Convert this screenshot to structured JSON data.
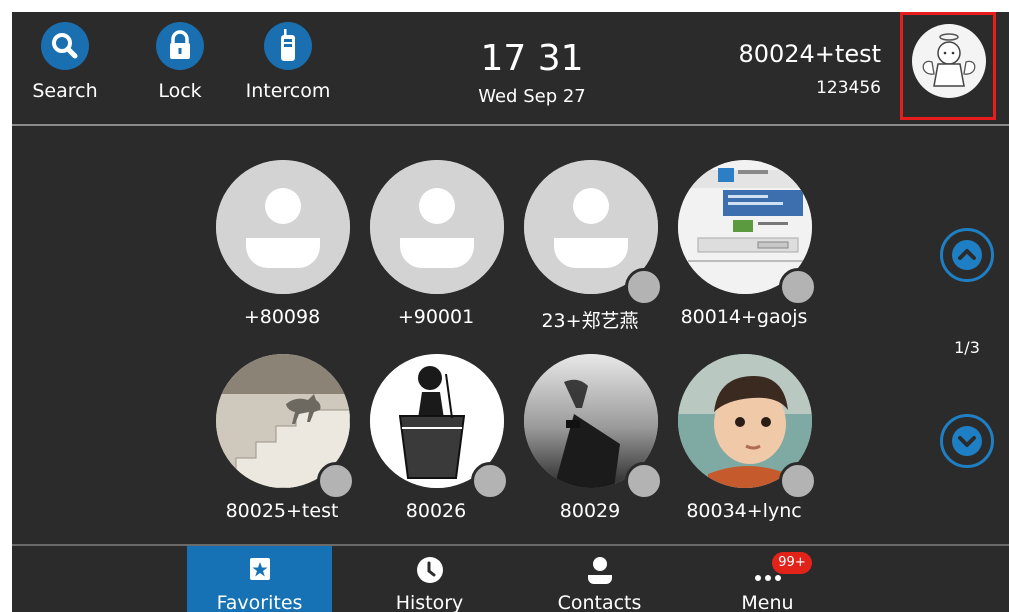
{
  "topbar": {
    "search_label": "Search",
    "lock_label": "Lock",
    "intercom_label": "Intercom",
    "time": "17 31",
    "date": "Wed Sep 27",
    "account_name": "80024+test",
    "account_number": "123456",
    "accent_color": "#1a6fb0",
    "presence": "available"
  },
  "favorites": [
    {
      "name": "+80098",
      "photo": "default-avatar"
    },
    {
      "name": "+90001",
      "photo": "default-avatar"
    },
    {
      "name": "23+郑艺燕",
      "photo": "default-avatar"
    },
    {
      "name": "80014+gaojs",
      "photo": "screenshot-photo"
    },
    {
      "name": "80025+test",
      "photo": "cat-on-stairs-photo"
    },
    {
      "name": "80026",
      "photo": "cartoon-girl-in-glass-photo"
    },
    {
      "name": "80029",
      "photo": "person-on-pier-photo"
    },
    {
      "name": "80034+lync",
      "photo": "child-photo"
    }
  ],
  "pager": {
    "page": "1/3",
    "up_icon": "chevron-up-icon",
    "down_icon": "chevron-down-icon"
  },
  "nav": {
    "favorites_label": "Favorites",
    "history_label": "History",
    "contacts_label": "Contacts",
    "menu_label": "Menu",
    "menu_badge": "99+",
    "active": "Favorites",
    "active_color": "#1672b4"
  }
}
